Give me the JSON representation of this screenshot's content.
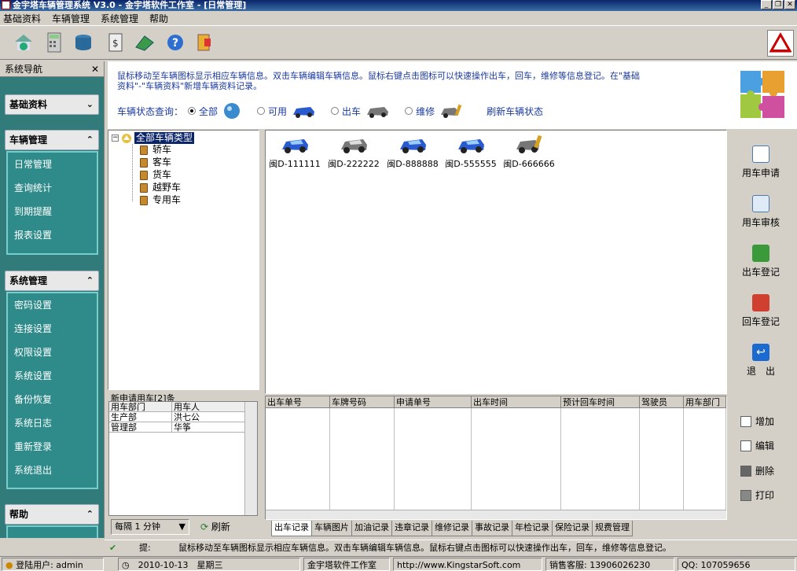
{
  "window": {
    "title": "金宇塔车辆管理系统 V3.0 - 金宇塔软件工作室 - [日常管理]"
  },
  "menu": [
    "基础资料",
    "车辆管理",
    "系统管理",
    "帮助"
  ],
  "sidebar": {
    "title": "系统导航",
    "close": "✕",
    "sections": [
      {
        "label": "基础资料",
        "chev": "⌄",
        "items": []
      },
      {
        "label": "车辆管理",
        "chev": "⌃",
        "items": [
          "日常管理",
          "查询统计",
          "到期提醒",
          "报表设置"
        ]
      },
      {
        "label": "系统管理",
        "chev": "⌃",
        "items": [
          "密码设置",
          "连接设置",
          "权限设置",
          "系统设置",
          "备份恢复",
          "系统日志",
          "重新登录",
          "系统退出"
        ]
      },
      {
        "label": "帮助",
        "chev": "⌃",
        "items": []
      }
    ]
  },
  "info": {
    "line1": "鼠标移动至车辆图标显示相应车辆信息。双击车辆编辑车辆信息。鼠标右键点击图标可以快速操作出车，回车，维修等信息登记。在\"基础",
    "line2": "资料\"-\"车辆资料\"新增车辆资料记录。",
    "query_label": "车辆状态查询：",
    "options": [
      "全部",
      "可用",
      "出车",
      "维修"
    ],
    "refresh": "刷新车辆状态"
  },
  "tree": {
    "root": "全部车辆类型",
    "children": [
      "轿车",
      "客车",
      "货车",
      "越野车",
      "专用车"
    ]
  },
  "requests": {
    "caption": "新申请用车[2]条",
    "columns": [
      "用车部门",
      "用车人"
    ],
    "rows": [
      [
        "生产部",
        "洪七公"
      ],
      [
        "管理部",
        "华筝"
      ]
    ],
    "interval": "每隔 1 分钟",
    "refresh": "刷新"
  },
  "cars": [
    {
      "plate": "闽D-111111",
      "status": "blue"
    },
    {
      "plate": "闽D-222222",
      "status": "gray"
    },
    {
      "plate": "闽D-888888",
      "status": "blue"
    },
    {
      "plate": "闽D-555555",
      "status": "blue"
    },
    {
      "plate": "闽D-666666",
      "status": "repair"
    }
  ],
  "actions": [
    "用车申请",
    "用车审核",
    "出车登记",
    "回车登记",
    "退　出"
  ],
  "detail": {
    "columns": [
      "出车单号",
      "车牌号码",
      "申请单号",
      "出车时间",
      "预计回车时间",
      "驾驶员",
      "用车部门"
    ]
  },
  "tabs": [
    "出车记录",
    "车辆图片",
    "加油记录",
    "违章记录",
    "维修记录",
    "事故记录",
    "年检记录",
    "保险记录",
    "规费管理"
  ],
  "edit_buttons": [
    "增加",
    "编辑",
    "删除",
    "打印"
  ],
  "tip": {
    "label": "提:",
    "text": "鼠标移动至车辆图标显示相应车辆信息。双击车辆编辑车辆信息。鼠标右键点击图标可以快速操作出车，回车，维修等信息登记。"
  },
  "status": {
    "user": "登陆用户: admin",
    "date": "2010-10-13　星期三",
    "company": "金宇塔软件工作室",
    "url": "http://www.KingstarSoft.com",
    "sales": "销售客服: 13906026230",
    "qq": "QQ: 107059656"
  },
  "colors": {
    "sidebar": "#317b7b",
    "info_text": "#1a3aa0",
    "titlebar": "#0a246a"
  }
}
